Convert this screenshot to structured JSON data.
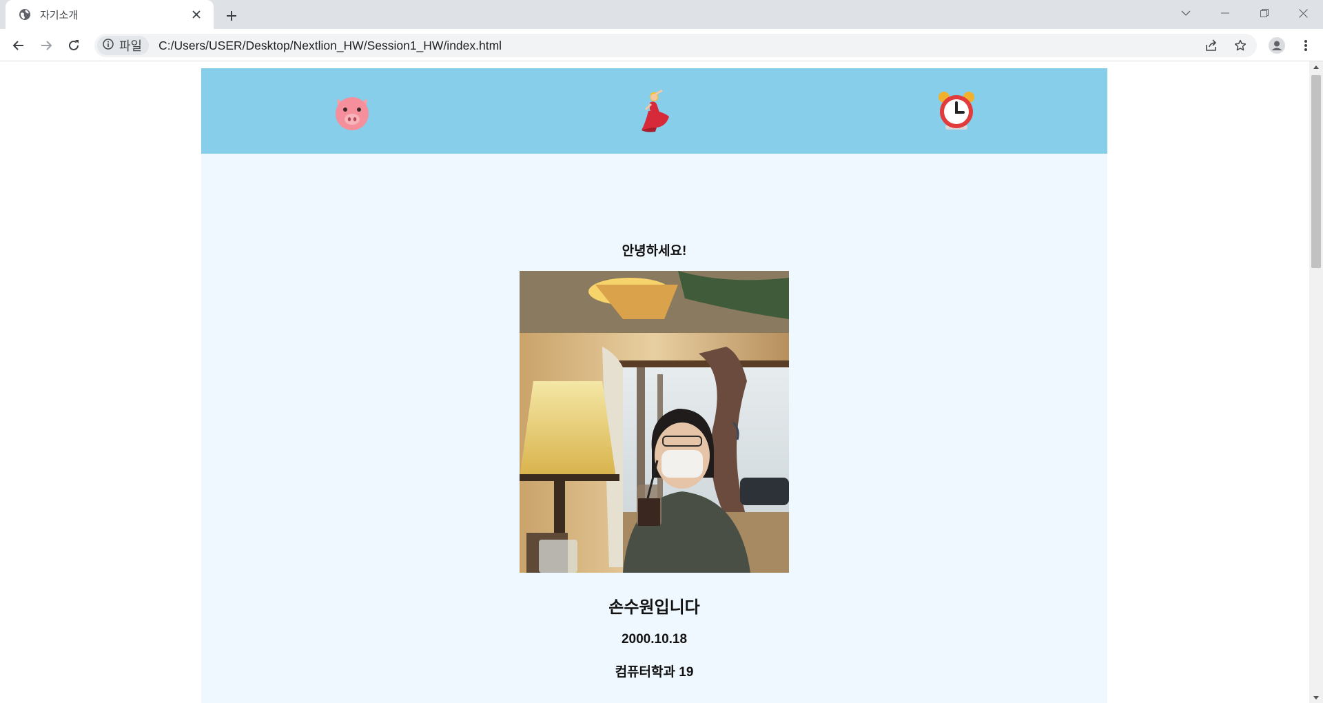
{
  "browser": {
    "tab": {
      "title": "자기소개",
      "favicon": "globe-icon"
    },
    "new_tab_icon": "plus-icon",
    "window_controls": [
      "tab-search-icon",
      "minimize-icon",
      "restore-icon",
      "close-icon"
    ],
    "toolbar": {
      "back_icon": "back-arrow-icon",
      "forward_icon": "forward-arrow-icon",
      "reload_icon": "reload-icon",
      "site_info_label": "파일",
      "url": "C:/Users/USER/Desktop/Nextlion_HW/Session1_HW/index.html",
      "share_icon": "share-icon",
      "bookmark_icon": "star-icon",
      "profile_icon": "profile-icon",
      "menu_icon": "kebab-menu-icon"
    }
  },
  "page": {
    "nav": [
      {
        "emoji": "pig-face-icon"
      },
      {
        "emoji": "dancer-icon"
      },
      {
        "emoji": "alarm-clock-icon"
      }
    ],
    "greeting": "안녕하세요!",
    "photo": "profile-photo",
    "name": "손수원입니다",
    "birth": "2000.10.18",
    "major": "컴퓨터학과 19"
  },
  "colors": {
    "header_bg": "#87ceeb",
    "page_bg": "#f0f8ff",
    "tabstrip_bg": "#dee1e6"
  }
}
